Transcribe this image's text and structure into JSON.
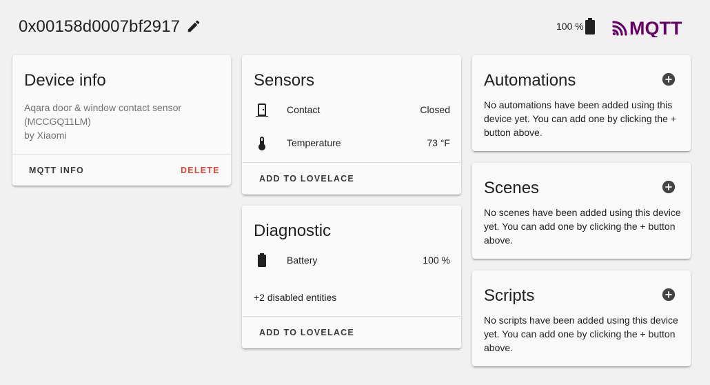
{
  "header": {
    "device_name": "0x00158d0007bf2917",
    "battery": "100 %",
    "integration_logo_text": "MQTT"
  },
  "device_info": {
    "title": "Device info",
    "model": "Aqara door & window contact sensor (MCCGQ11LM)",
    "manufacturer": "by Xiaomi",
    "mqtt_info_label": "MQTT INFO",
    "delete_label": "DELETE"
  },
  "sensors": {
    "title": "Sensors",
    "rows": [
      {
        "icon": "door-icon",
        "label": "Contact",
        "value": "Closed"
      },
      {
        "icon": "thermometer-icon",
        "label": "Temperature",
        "value": "73 °F"
      }
    ],
    "add_label": "ADD TO LOVELACE"
  },
  "diagnostic": {
    "title": "Diagnostic",
    "rows": [
      {
        "icon": "battery-icon",
        "label": "Battery",
        "value": "100 %"
      }
    ],
    "disabled_entities": "+2 disabled entities",
    "add_label": "ADD TO LOVELACE"
  },
  "automations": {
    "title": "Automations",
    "empty_text": "No automations have been added using this device yet. You can add one by clicking the + button above."
  },
  "scenes": {
    "title": "Scenes",
    "empty_text": "No scenes have been added using this device yet. You can add one by clicking the + button above."
  },
  "scripts": {
    "title": "Scripts",
    "empty_text": "No scripts have been added using this device yet. You can add one by clicking the + button above."
  },
  "colors": {
    "background": "#f1f1f1",
    "card": "#fafafa",
    "delete": "#db4437",
    "mqtt_brand": "#660066",
    "icon": "#212121"
  }
}
